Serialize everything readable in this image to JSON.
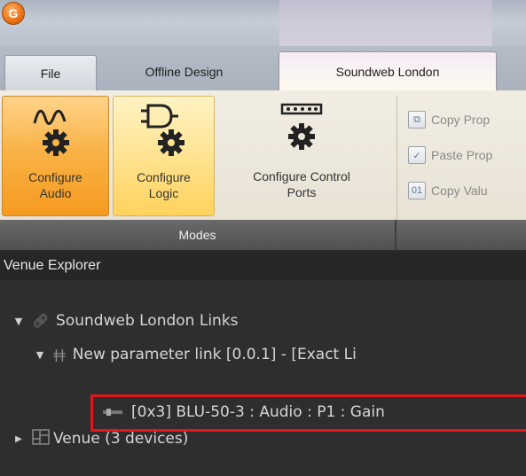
{
  "app": {
    "orb_letter": "G"
  },
  "tabs": [
    {
      "label": "File"
    },
    {
      "label": "Offline Design"
    },
    {
      "label": "Soundweb London"
    }
  ],
  "ribbon": {
    "buttons": [
      {
        "label_line1": "Configure",
        "label_line2": "Audio",
        "icon": "audio-wave-gear-icon",
        "state": "active"
      },
      {
        "label_line1": "Configure",
        "label_line2": "Logic",
        "icon": "logic-gate-gear-icon",
        "state": "hover"
      },
      {
        "label_line1": "Configure Control",
        "label_line2": "Ports",
        "icon": "control-ports-gear-icon",
        "state": "normal"
      }
    ],
    "modes_label": "Modes",
    "small_commands": [
      {
        "label": "Copy Prop",
        "icon": "copy-properties-icon"
      },
      {
        "label": "Paste Prop",
        "icon": "paste-properties-icon"
      },
      {
        "label": "Copy Valu",
        "icon": "copy-values-icon"
      }
    ]
  },
  "venue_explorer": {
    "title": "Venue Explorer",
    "tree": [
      {
        "label": "Soundweb London Links",
        "expanded": true,
        "icon": "link-icon"
      },
      {
        "label": "New parameter link  [0.0.1]  -  [Exact Li",
        "expanded": true,
        "icon": "parameter-link-icon"
      },
      {
        "label": "[0x3] BLU-50-3 : Audio : P1 : Gain",
        "icon": "parameter-slider-icon",
        "highlighted": true
      },
      {
        "label": "Venue (3 devices)",
        "expanded": false,
        "icon": "venue-devices-icon"
      }
    ]
  },
  "colors": {
    "highlight": "#e8141b",
    "active_button": "#f69a1f",
    "hover_button": "#ffe391"
  }
}
